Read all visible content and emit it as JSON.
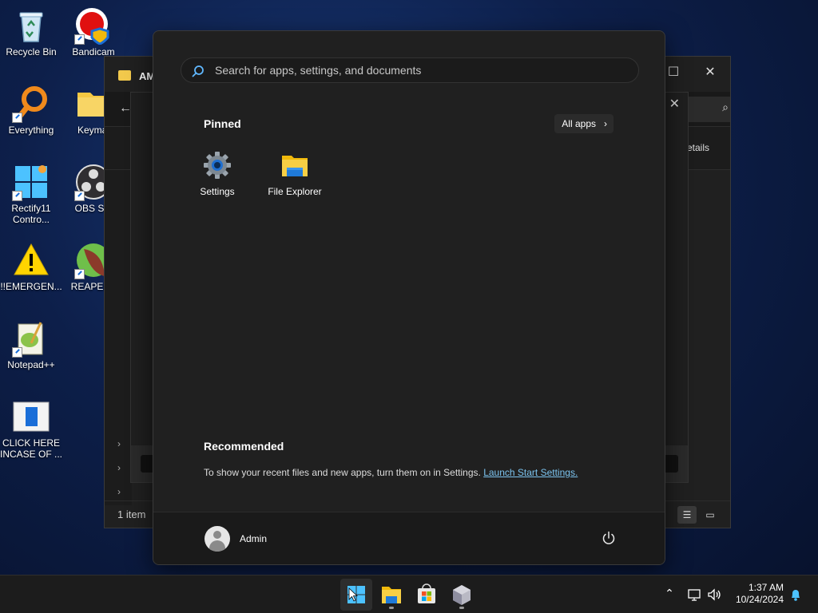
{
  "desktop": {
    "icons": [
      {
        "label": "Recycle Bin"
      },
      {
        "label": "Bandicam"
      },
      {
        "label": "Everything"
      },
      {
        "label": "Keymal"
      },
      {
        "label": "Rectify11 Contro..."
      },
      {
        "label": "OBS Stu"
      },
      {
        "label": "!!EMERGEN..."
      },
      {
        "label": "REAPER ("
      },
      {
        "label": "Notepad++"
      },
      {
        "label": "CLICK HERE INCASE OF ..."
      }
    ]
  },
  "explorer": {
    "title": "AM",
    "details_label": "etails",
    "status": "1 item"
  },
  "start_menu": {
    "search_placeholder": "Search for apps, settings, and documents",
    "pinned_title": "Pinned",
    "all_apps_label": "All apps",
    "pinned": [
      {
        "label": "Settings"
      },
      {
        "label": "File Explorer"
      }
    ],
    "recommended_title": "Recommended",
    "recommended_text": "To show your recent files and new apps, turn them on in Settings.",
    "recommended_link": "Launch Start Settings.",
    "user_name": "Admin"
  },
  "taskbar": {
    "time": "1:37 AM",
    "date": "10/24/2024"
  },
  "colors": {
    "accent": "#0078d4",
    "link": "#7cc4f0",
    "menu_bg": "#202020"
  }
}
